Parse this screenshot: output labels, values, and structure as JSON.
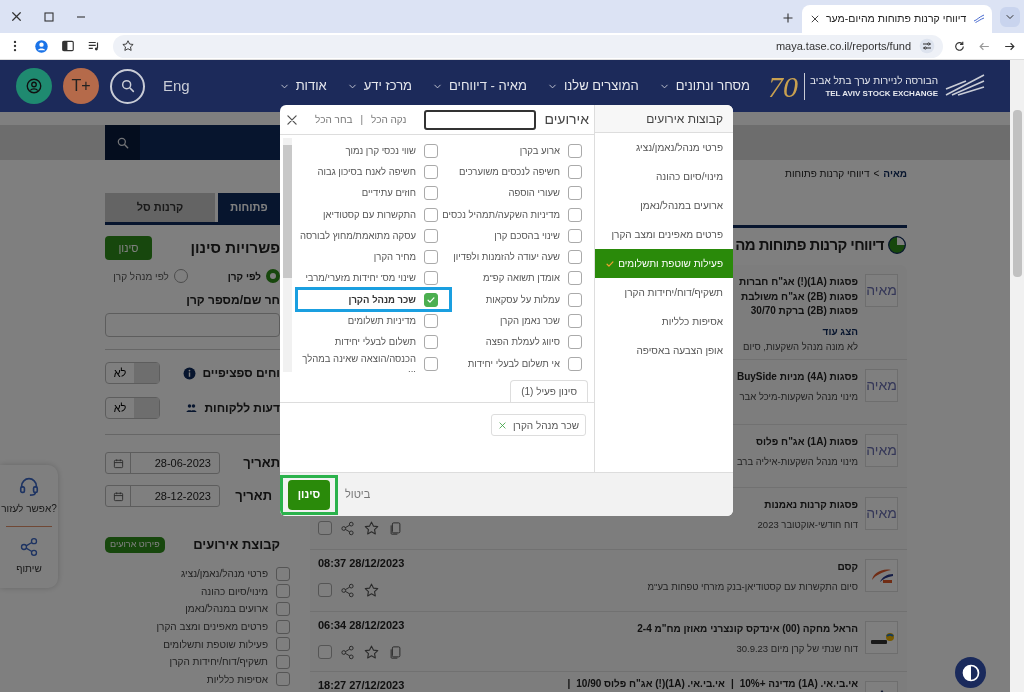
{
  "browser": {
    "tab_title": "דיווחי קרנות פתוחות מהיום-מער",
    "url": "maya.tase.co.il/reports/fund"
  },
  "header": {
    "logo": {
      "anniversary": "70",
      "name_he": "הבורסה לניירות ערך בתל אביב",
      "name_en": "TEL AVIV STOCK EXCHANGE"
    },
    "nav": [
      "מסחר ונתונים",
      "המוצרים שלנו",
      "מאיה - דיווחים",
      "מרכז ידע",
      "אודות"
    ],
    "language": "Eng",
    "text_size_button": "T+"
  },
  "breadcrumb": {
    "home": "מאיה",
    "separator": ">",
    "current": "דיווחי קרנות פתוחות"
  },
  "filters": {
    "tabs": [
      {
        "label": "פתוחות",
        "selected": true
      },
      {
        "label": "קרנות סל",
        "selected": false
      }
    ],
    "heading": "פשרויות סינון",
    "filter_button": "סינון",
    "radios": [
      {
        "label": "לפי קרן",
        "selected": true
      },
      {
        "label": "לפי מנהל קרן",
        "selected": false
      }
    ],
    "search_label": "חר שם/מספר קרן",
    "toggles": [
      {
        "kind": "info",
        "label": "וחים ספציפיים",
        "value": "לא"
      },
      {
        "kind": "clients",
        "label": "דעות ללקוחות",
        "value": "לא"
      }
    ],
    "dates": [
      {
        "label": "תאריך",
        "value": "28-06-2023"
      },
      {
        "label": "תאריך",
        "value": "28-12-2023"
      }
    ],
    "events_heading": "קבוצת אירועים",
    "events_badge": "פירוט ארועים",
    "event_groups": [
      {
        "label": "פרטי מנהל/נאמן/נציג",
        "checked": false
      },
      {
        "label": "מינוי/סיום כהונה",
        "checked": false
      },
      {
        "label": "ארועים במנהל/נאמן",
        "checked": false
      },
      {
        "label": "פרטים מאפינים ומצב הקרן",
        "checked": false
      },
      {
        "label": "פעילות שוטפת ותשלומים",
        "checked": false
      },
      {
        "label": "תשקיף/דוח/יחידות הקרן",
        "checked": false
      },
      {
        "label": "אסיפות כלליות",
        "checked": false
      }
    ]
  },
  "help_widget": {
    "help": "אפשר לעזור?",
    "share": "שיתוף"
  },
  "page_title": "דיווחי קרנות פתוחות מה",
  "reports": [
    {
      "kind": "maya",
      "logo_text": "מאיה",
      "titles": [
        "פסגות (1A)(!) אג\"ח חברות",
        "פסגות (2B) אג\"ח משולבת",
        "פסגות (2B) ברקת 30/70"
      ],
      "more_link": "הצג עוד",
      "subtitle": "לא מונה מנהל השקעות, סיום"
    },
    {
      "kind": "maya",
      "logo_text": "מאיה",
      "titles": [
        "פסגות (4A) מניות BuySide"
      ],
      "subtitle": "מינוי מנהל השקעות-מיכל אבר"
    },
    {
      "kind": "maya",
      "logo_text": "מאיה",
      "titles": [
        "פסגות (1A) אג\"ח פלוס"
      ],
      "subtitle": "מינוי מנהל השקעות-איליה ברב"
    },
    {
      "kind": "maya",
      "logo_text": "מאיה",
      "titles": [
        "פסגות קרנות נאמנות"
      ],
      "subtitle": "דוח חודשי-אוקטובר 2023",
      "actions": {
        "checked": false,
        "copy": true
      }
    },
    {
      "kind": "kasam",
      "titles": [
        "קסם"
      ],
      "subtitle": "סיום התקשרות עם קסטודיאן-בנק מזרחי טפחות בע\"מ",
      "time": "08:37 28/12/2023",
      "actions": {
        "checked": false,
        "copy": false
      }
    },
    {
      "kind": "harel",
      "titles": [
        "הראל מחקה (00) אינדקס קונצרני מאוזן מח\"מ 2-4"
      ],
      "subtitle": "דוח שנתי של קרן מיום 30.9.23",
      "time": "06:34 28/12/2023",
      "actions": {
        "checked": false,
        "copy": true
      }
    },
    {
      "kind": "ibi",
      "titles": [
        "אי.בי.אי. (1A) מדינה +10%",
        "אי.בי.אי. (1A)(!) אג\"ח פלוס 10/90"
      ],
      "separator": "|",
      "time": "18:27 27/12/2023"
    }
  ],
  "modal": {
    "groups_title": "קבוצות אירועים",
    "groups": [
      {
        "label": "פרטי מנהל/נאמן/נציג",
        "selected": false
      },
      {
        "label": "מינוי/סיום כהונה",
        "selected": false
      },
      {
        "label": "ארועים במנהל/נאמן",
        "selected": false
      },
      {
        "label": "פרטים מאפינים ומצב הקרן",
        "selected": false
      },
      {
        "label": "פעילות שוטפת ותשלומים",
        "selected": true
      },
      {
        "label": "תשקיף/דוח/יחידות הקרן",
        "selected": false
      },
      {
        "label": "אסיפות כלליות",
        "selected": false
      },
      {
        "label": "אופן הצבעה באסיפה",
        "selected": false
      }
    ],
    "events_title": "אירועים",
    "clear_all": "נקה הכל",
    "separator": "|",
    "select_all": "בחר הכל",
    "events": [
      {
        "label": "ארוע בקרן",
        "checked": false,
        "highlighted": false
      },
      {
        "label": "שווי נכסי קרן נמוך",
        "checked": false,
        "highlighted": false
      },
      {
        "label": "חשיפה לנכסים משוערכים",
        "checked": false,
        "highlighted": false
      },
      {
        "label": "חשיפה לאנח בסיכון גבוה",
        "checked": false,
        "highlighted": false
      },
      {
        "label": "שעורי הוספה",
        "checked": false,
        "highlighted": false
      },
      {
        "label": "חוזים עתידיים",
        "checked": false,
        "highlighted": false
      },
      {
        "label": "מדיניות השקעה/תמהיל נכסים",
        "checked": false,
        "highlighted": false
      },
      {
        "label": "התקשרות עם קסטודיאן",
        "checked": false,
        "highlighted": false
      },
      {
        "label": "שינוי בהסכם קרן",
        "checked": false,
        "highlighted": false
      },
      {
        "label": "עסקה מתואמת/מחוץ לבורסה",
        "checked": false,
        "highlighted": false
      },
      {
        "label": "שעה יעודה להזמנות ולפדיון",
        "checked": false,
        "highlighted": false
      },
      {
        "label": "מחיר הקרן",
        "checked": false,
        "highlighted": false
      },
      {
        "label": "אומדן תשואה קפ\"מ",
        "checked": false,
        "highlighted": false
      },
      {
        "label": "שינוי מס' יחידות מזערי/מרבי",
        "checked": false,
        "highlighted": false
      },
      {
        "label": "עמלות על עסקאות",
        "checked": false,
        "highlighted": false
      },
      {
        "label": "שכר מנהל הקרן",
        "checked": true,
        "highlighted": true
      },
      {
        "label": "שכר נאמן הקרן",
        "checked": false,
        "highlighted": false
      },
      {
        "label": "מדיניות תשלומים",
        "checked": false,
        "highlighted": false
      },
      {
        "label": "סיווג לעמלת הפצה",
        "checked": false,
        "highlighted": false
      },
      {
        "label": "תשלום לבעלי יחידות",
        "checked": false,
        "highlighted": false
      },
      {
        "label": "אי תשלום לבעלי יחידות",
        "checked": false,
        "highlighted": false
      },
      {
        "label": "הכנסה/הוצאה שאינה במהלך ...",
        "checked": false,
        "highlighted": false
      }
    ],
    "active_tab": "סינון פעיל (1)",
    "chips": [
      {
        "label": "שכר מנהל הקרן"
      }
    ],
    "apply": {
      "label": "סינון",
      "highlighted": true
    },
    "cancel": "ביטול"
  }
}
